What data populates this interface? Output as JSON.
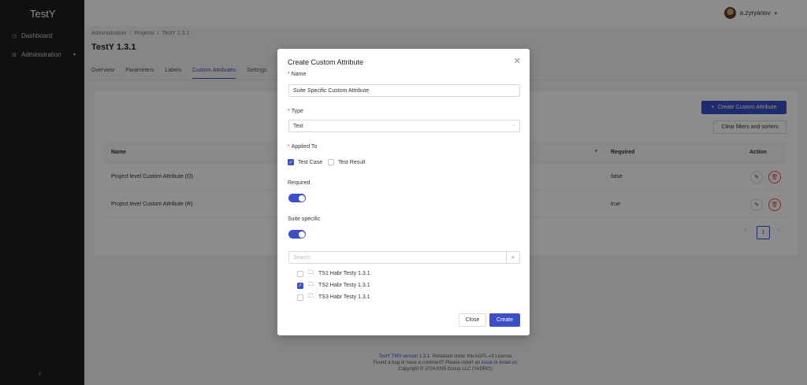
{
  "app": {
    "name": "TestY"
  },
  "sidebar": {
    "items": [
      {
        "label": "Dashboard",
        "icon": "dashboard-icon"
      },
      {
        "label": "Administration",
        "icon": "gear-icon"
      }
    ],
    "collapse_icon": "‹"
  },
  "header": {
    "user": "a.zyryanov"
  },
  "breadcrumb": [
    "Administration",
    "/",
    "Projects",
    "/",
    "TestY 1.3.1"
  ],
  "page_title": "TestY 1.3.1",
  "tabs": [
    "Overview",
    "Parameters",
    "Labels",
    "Custom Attributes",
    "Settings"
  ],
  "toolbar": {
    "create_label": "Create Custom Attribute",
    "clear_label": "Clear filters and sorters"
  },
  "table": {
    "headers": {
      "name": "Name",
      "required": "Required",
      "action": "Action"
    },
    "rows": [
      {
        "name": "Project level Custom Attribute (O)",
        "required": "false"
      },
      {
        "name": "Project level Custom Attribute (R)",
        "required": "true"
      }
    ]
  },
  "pagination": {
    "current": "1"
  },
  "footer": {
    "line1_link": "TestY TMS version 1.3.1",
    "line1_rest": ". Released under the AGPL-v3 License.",
    "line2_a": "Found a bug or have a comment? Please report an ",
    "line2_issue": "issue",
    "line2_b": " or ",
    "line2_email": "email us",
    "line2_c": ".",
    "line3": "Copyright © 2024 KNS Group LLC (YADRO)."
  },
  "modal": {
    "title": "Create Custom Attribute",
    "name_label": "Name",
    "name_value": "Suite Specific Custom Attribute",
    "type_label": "Type",
    "type_value": "Text",
    "applied_label": "Applied To",
    "applied_options": [
      {
        "label": "Test Case",
        "checked": true
      },
      {
        "label": "Test Result",
        "checked": false
      }
    ],
    "required_label": "Required",
    "required_on": true,
    "suite_specific_label": "Suite specific",
    "suite_specific_on": true,
    "search_placeholder": "Search",
    "suites": [
      {
        "label": "TS1 Habr Testy 1.3.1",
        "checked": false
      },
      {
        "label": "TS2 Habr Testy 1.3.1",
        "checked": true
      },
      {
        "label": "TS3 Habr Testy 1.3.1",
        "checked": false
      }
    ],
    "close_label": "Close",
    "create_label": "Create"
  },
  "colors": {
    "accent": "#3b4fc7",
    "danger": "#e05555",
    "sidebar": "#1e1e1e"
  }
}
